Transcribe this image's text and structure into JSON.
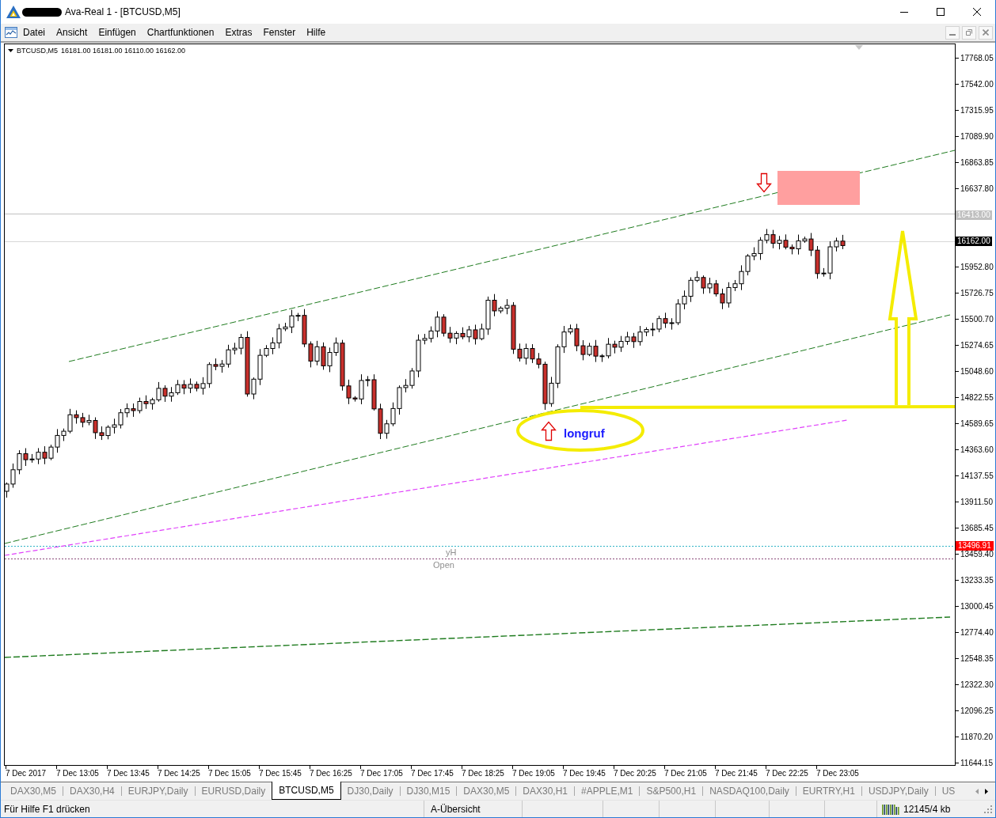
{
  "window": {
    "title": "Ava-Real 1 - [BTCUSD,M5]"
  },
  "menu": [
    "Datei",
    "Ansicht",
    "Einfügen",
    "Chartfunktionen",
    "Extras",
    "Fenster",
    "Hilfe"
  ],
  "chart": {
    "symbol": "BTCUSD,M5",
    "quote": "16181.00 16181.00 16110.00 16162.00",
    "note": "longruf",
    "line_labels": [
      {
        "kind": "high",
        "label": "yH"
      },
      {
        "kind": "open",
        "label": "Open"
      }
    ],
    "price_axis": [
      {
        "kind": "tick",
        "label": "17768.05"
      },
      {
        "kind": "tick",
        "label": "17542.00"
      },
      {
        "kind": "tick",
        "label": "17315.95"
      },
      {
        "kind": "tick",
        "label": "17089.90"
      },
      {
        "kind": "tick",
        "label": "16863.85"
      },
      {
        "kind": "tick",
        "label": "16637.80"
      },
      {
        "kind": "marker",
        "label": "16413.00",
        "color": "#c0c0c0"
      },
      {
        "kind": "marker",
        "label": "16162.00",
        "color": "#000000"
      },
      {
        "kind": "tick",
        "label": "15952.80"
      },
      {
        "kind": "tick",
        "label": "15726.75"
      },
      {
        "kind": "tick",
        "label": "15500.70"
      },
      {
        "kind": "tick",
        "label": "15274.65"
      },
      {
        "kind": "tick",
        "label": "15048.60"
      },
      {
        "kind": "tick",
        "label": "14822.55"
      },
      {
        "kind": "tick",
        "label": "14589.65"
      },
      {
        "kind": "tick",
        "label": "14363.60"
      },
      {
        "kind": "tick",
        "label": "14137.55"
      },
      {
        "kind": "tick",
        "label": "13911.50"
      },
      {
        "kind": "tick",
        "label": "13685.45"
      },
      {
        "kind": "tick",
        "label": "13459.40"
      },
      {
        "kind": "tick",
        "label": "13233.35"
      },
      {
        "kind": "tick",
        "label": "13000.45"
      },
      {
        "kind": "tick",
        "label": "12774.40"
      },
      {
        "kind": "tick",
        "label": "12548.35"
      },
      {
        "kind": "tick",
        "label": "12322.30"
      },
      {
        "kind": "tick",
        "label": "12096.25"
      },
      {
        "kind": "tick",
        "label": "11870.20"
      },
      {
        "kind": "tick",
        "label": "11644.15"
      }
    ],
    "alert_price": {
      "label": "13496.91",
      "color": "#ff0000"
    },
    "time_axis": [
      "7 Dec 2017",
      "7 Dec 13:05",
      "7 Dec 13:45",
      "7 Dec 14:25",
      "7 Dec 15:05",
      "7 Dec 15:45",
      "7 Dec 16:25",
      "7 Dec 17:05",
      "7 Dec 17:45",
      "7 Dec 18:25",
      "7 Dec 19:05",
      "7 Dec 19:45",
      "7 Dec 20:25",
      "7 Dec 21:05",
      "7 Dec 21:45",
      "7 Dec 22:25",
      "7 Dec 23:05"
    ]
  },
  "tabs": [
    {
      "label": "DAX30,M5",
      "selected": false
    },
    {
      "label": "DAX30,H4",
      "selected": false
    },
    {
      "label": "EURJPY,Daily",
      "selected": false
    },
    {
      "label": "EURUSD,Daily",
      "selected": false
    },
    {
      "label": "BTCUSD,M5",
      "selected": true
    },
    {
      "label": "DJ30,Daily",
      "selected": false
    },
    {
      "label": "DJ30,M15",
      "selected": false
    },
    {
      "label": "DAX30,M5",
      "selected": false
    },
    {
      "label": "DAX30,H1",
      "selected": false
    },
    {
      "label": "#APPLE,M1",
      "selected": false
    },
    {
      "label": "S&P500,H1",
      "selected": false
    },
    {
      "label": "NASDAQ100,Daily",
      "selected": false
    },
    {
      "label": "EURTRY,H1",
      "selected": false
    },
    {
      "label": "USDJPY,Daily",
      "selected": false
    },
    {
      "label": "US",
      "selected": false
    }
  ],
  "status_bar": {
    "help": "Für Hilfe F1 drücken",
    "profile": "A-Übersicht",
    "traffic": "12145/4 kb"
  }
}
